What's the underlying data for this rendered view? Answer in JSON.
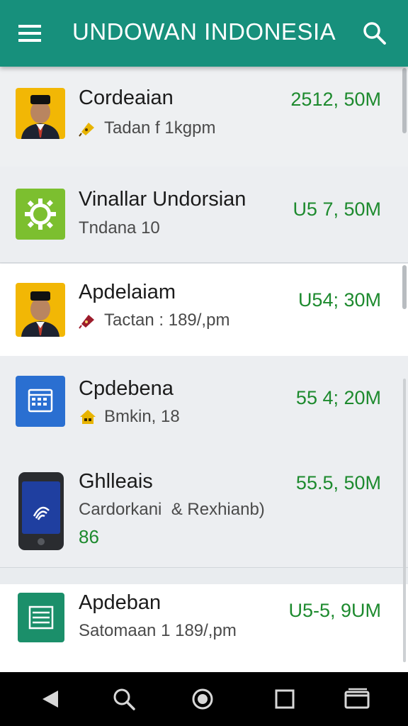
{
  "app": {
    "title": "UNDOWAN INDONESIA",
    "bar_color": "#17907c",
    "amount_color": "#1d8a2e"
  },
  "items": [
    {
      "name": "Cordeaian",
      "subtitle": "Tadan f 1kgpm",
      "amount": "2512, 50M",
      "icon": "portrait-icon",
      "sub_icon": "tag-icon"
    },
    {
      "name": "Vinallar Undorsian",
      "subtitle": "Tndana 10",
      "amount": "U5 7, 50M",
      "icon": "gear-icon"
    },
    {
      "name": "Apdelaiam",
      "subtitle": "Tactan : 189/,pm",
      "amount": "U54; 30M",
      "icon": "portrait-icon",
      "sub_icon": "tag-icon"
    },
    {
      "name": "Cpdebena",
      "subtitle": "Bmkin, 18",
      "amount": "55 4; 20M",
      "icon": "calendar-icon",
      "sub_icon": "home-icon"
    },
    {
      "name": "Ghlleais",
      "subtitle": "Cardorkani  & Rexhianb)",
      "extra": "86",
      "amount": "55.5, 50M",
      "icon": "phone-icon"
    },
    {
      "name": "Apdeban",
      "subtitle": "Satomaan 1 189/,pm",
      "amount": "U5-5, 9UM",
      "icon": "document-icon"
    }
  ],
  "navigation": [
    "back-icon",
    "search-icon",
    "home-icon",
    "recents-icon",
    "window-icon"
  ]
}
